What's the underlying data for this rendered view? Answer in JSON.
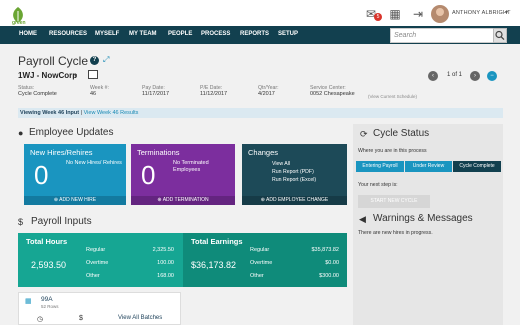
{
  "app": {
    "logo_text": "green"
  },
  "header": {
    "user_name": "ANTHONY ALBRIGHT",
    "notification_count": "5"
  },
  "nav": {
    "items": [
      "HOME",
      "RESOURCES",
      "MYSELF",
      "MY TEAM",
      "PEOPLE",
      "PROCESS",
      "REPORTS",
      "SETUP"
    ],
    "search_placeholder": "Search"
  },
  "page": {
    "title": "Payroll Cycle",
    "company": "1WJ - NowCorp",
    "pager": "1 of 1",
    "info": {
      "status_label": "Status:",
      "status_value": "Cycle Complete",
      "week_label": "Week #:",
      "week_value": "46",
      "pay_date_label": "Pay Date:",
      "pay_date_value": "11/17/2017",
      "pe_date_label": "P/E Date:",
      "pe_date_value": "11/12/2017",
      "qtr_year_label": "Qtr/Year:",
      "qtr_year_value": "4/2017",
      "service_center_label": "Service Center:",
      "service_center_value": "0052  Chesapeake",
      "view_schedule": "(View Current Schedule)"
    },
    "viewing": {
      "label": "Viewing",
      "text": "Week 46 Input",
      "link": "View Week 46 Results"
    }
  },
  "employee_updates": {
    "title": "Employee Updates",
    "hires": {
      "title": "New Hires/Rehires",
      "count": "0",
      "note": "No New Hires/ Rehires",
      "action": "ADD NEW HIRE"
    },
    "terminations": {
      "title": "Terminations",
      "count": "0",
      "note": "No Terminated Employees",
      "action": "ADD TERMINATION"
    },
    "changes": {
      "title": "Changes",
      "links": [
        "View All",
        "Run Report (PDF)",
        "Run Report (Excel)"
      ],
      "action": "ADD EMPLOYEE CHANGE"
    }
  },
  "payroll_inputs": {
    "title": "Payroll Inputs",
    "total_hours": {
      "title": "Total Hours",
      "value": "2,593.50",
      "rows": [
        {
          "label": "Regular",
          "value": "2,325.50"
        },
        {
          "label": "Overtime",
          "value": "100.00"
        },
        {
          "label": "Other",
          "value": "168.00"
        }
      ]
    },
    "total_earnings": {
      "title": "Total Earnings",
      "value": "$36,173.82",
      "rows": [
        {
          "label": "Regular",
          "value": "$35,873.82"
        },
        {
          "label": "Overtime",
          "value": "$0.00"
        },
        {
          "label": "Other",
          "value": "$300.00"
        }
      ]
    },
    "batch": {
      "id": "99A",
      "rows": "52 Rows",
      "link": "View All Batches"
    }
  },
  "cycle_status": {
    "title": "Cycle Status",
    "intro": "Where you are in this process",
    "steps": [
      "Entering Payroll",
      "Under Review",
      "Cycle Complete"
    ],
    "next_label": "Your next step is:",
    "start_button": "START NEW CYCLE"
  },
  "warnings": {
    "title": "Warnings & Messages",
    "message": "There are new hires in progress."
  },
  "colors": {
    "nav": "#12404f",
    "blue": "#1a95c0",
    "purple": "#7c2e9e",
    "teal": "#16a693",
    "teal_dark": "#0f8b7a"
  }
}
